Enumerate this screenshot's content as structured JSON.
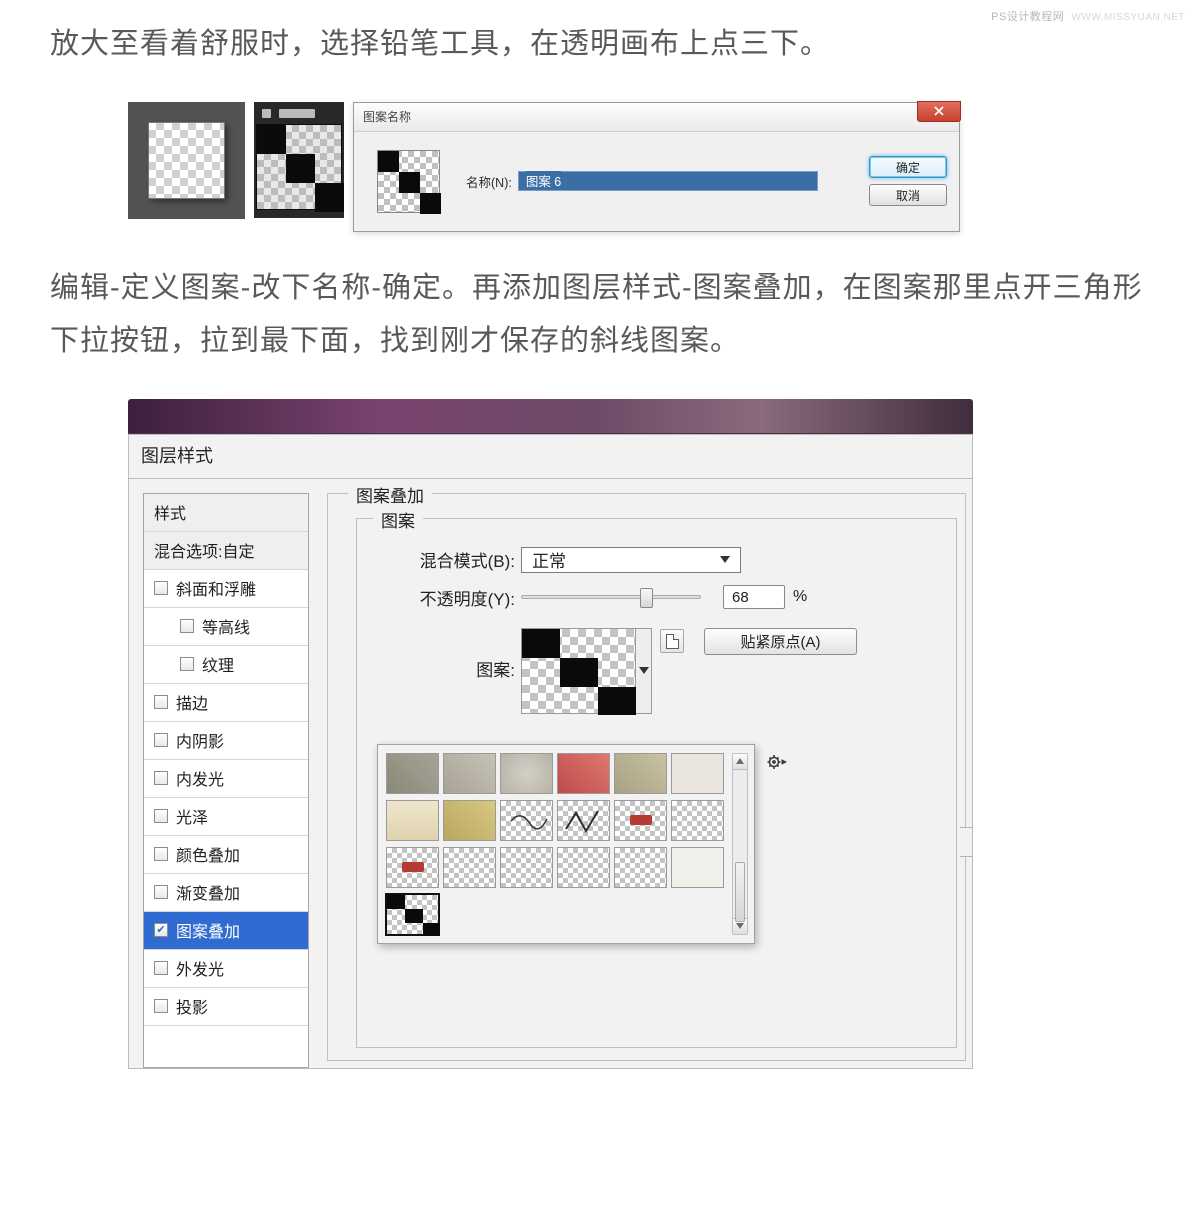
{
  "watermark": {
    "cn": "PS设计教程网",
    "en": "WWW.MISSYUAN.NET"
  },
  "para1": "放大至看着舒服时，选择铅笔工具，在透明画布上点三下。",
  "para2": "编辑-定义图案-改下名称-确定。再添加图层样式-图案叠加，在图案那里点开三角形下拉按钮，拉到最下面，找到刚才保存的斜线图案。",
  "patternNameDialog": {
    "title": "图案名称",
    "field_label": "名称(N):",
    "field_value": "图案 6",
    "ok": "确定",
    "cancel": "取消"
  },
  "layerStyle": {
    "window_title": "图层样式",
    "list": {
      "styles": "样式",
      "blending": "混合选项:自定",
      "bevel": "斜面和浮雕",
      "contour": "等高线",
      "texture": "纹理",
      "stroke": "描边",
      "innerShadow": "内阴影",
      "innerGlow": "内发光",
      "satin": "光泽",
      "colorOverlay": "颜色叠加",
      "gradientOverlay": "渐变叠加",
      "patternOverlay": "图案叠加",
      "outerGlow": "外发光",
      "dropShadow": "投影"
    },
    "panel": {
      "group_title": "图案叠加",
      "subgroup_title": "图案",
      "blend_label": "混合模式(B):",
      "blend_value": "正常",
      "opacity_label": "不透明度(Y):",
      "opacity_value": "68",
      "opacity_unit": "%",
      "pattern_label": "图案:",
      "snap_btn": "贴紧原点(A)"
    }
  }
}
